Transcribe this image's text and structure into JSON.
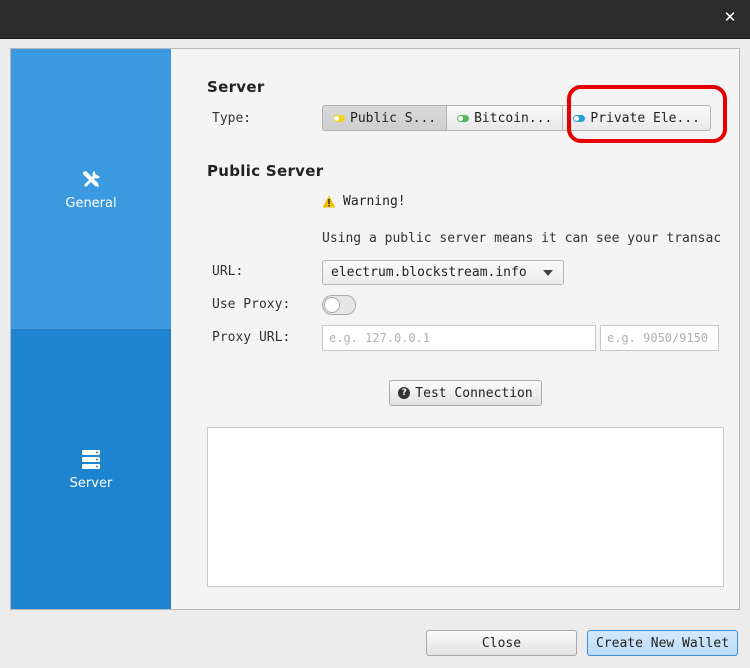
{
  "window": {
    "close_glyph": "✕"
  },
  "sidebar": {
    "items": [
      {
        "label": "General",
        "icon": "tools-icon"
      },
      {
        "label": "Server",
        "icon": "server-icon"
      }
    ]
  },
  "server_section": {
    "title": "Server",
    "type_label": "Type:",
    "types": [
      {
        "label": "Public S...",
        "dot_color": "#f2d21b",
        "selected": true
      },
      {
        "label": "Bitcoin...",
        "dot_color": "#5cb85c",
        "selected": false
      },
      {
        "label": "Private Ele...",
        "dot_color": "#2d9fd8",
        "selected": false
      }
    ]
  },
  "public_server": {
    "title": "Public Server",
    "warning_title": "Warning!",
    "warning_text": "Using a public server means it can see your transac",
    "url_label": "URL:",
    "url_value": "electrum.blockstream.info",
    "use_proxy_label": "Use Proxy:",
    "proxy_url_label": "Proxy URL:",
    "proxy_host_placeholder": "e.g. 127.0.0.1",
    "proxy_port_placeholder": "e.g. 9050/9150",
    "test_connection_label": "Test Connection"
  },
  "footer": {
    "close_label": "Close",
    "create_label": "Create New Wallet"
  },
  "colors": {
    "sidebar_general": "#3b99e0",
    "sidebar_server": "#1e84d0",
    "highlight": "#e60000",
    "warning": "#f0c000"
  }
}
